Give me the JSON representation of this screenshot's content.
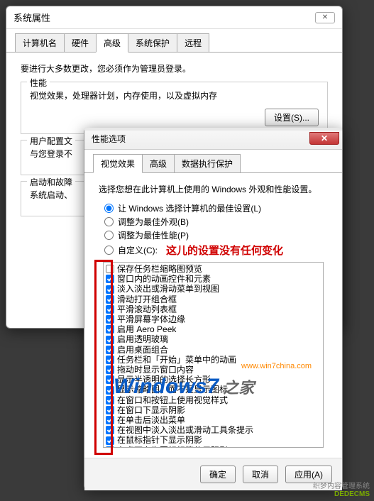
{
  "bg": {
    "title": "系统属性",
    "tabs": [
      "计算机名",
      "硬件",
      "高级",
      "系统保护",
      "远程"
    ],
    "active_tab": 2,
    "intro": "要进行大多数更改，您必须作为管理员登录。",
    "perf_title": "性能",
    "perf_desc": "视觉效果，处理器计划，内存使用，以及虚拟内存",
    "settings_btn": "设置(S)...",
    "profile_title": "用户配置文",
    "profile_desc": "与您登录不",
    "startup_title": "启动和故障",
    "startup_desc": "系统启动、"
  },
  "fg": {
    "title": "性能选项",
    "tabs": [
      "视觉效果",
      "高级",
      "数据执行保护"
    ],
    "active_tab": 0,
    "intro": "选择您想在此计算机上使用的 Windows 外观和性能设置。",
    "radios": [
      {
        "label": "让 Windows 选择计算机的最佳设置(L)",
        "checked": true
      },
      {
        "label": "调整为最佳外观(B)",
        "checked": false
      },
      {
        "label": "调整为最佳性能(P)",
        "checked": false
      },
      {
        "label": "自定义(C):",
        "checked": false
      }
    ],
    "annotation": "这儿的设置没有任何变化",
    "checks": [
      {
        "label": "保存任务栏缩略图预览",
        "checked": false
      },
      {
        "label": "窗口内的动画控件和元素",
        "checked": true
      },
      {
        "label": "淡入淡出或滑动菜单到视图",
        "checked": true
      },
      {
        "label": "滑动打开组合框",
        "checked": true
      },
      {
        "label": "平滑滚动列表框",
        "checked": true
      },
      {
        "label": "平滑屏幕字体边缘",
        "checked": true
      },
      {
        "label": "启用 Aero Peek",
        "checked": true
      },
      {
        "label": "启用透明玻璃",
        "checked": true
      },
      {
        "label": "启用桌面组合",
        "checked": true
      },
      {
        "label": "任务栏和「开始」菜单中的动画",
        "checked": true
      },
      {
        "label": "拖动时显示窗口内容",
        "checked": true
      },
      {
        "label": "显示半透明的选择长方形",
        "checked": true
      },
      {
        "label": "显示缩略图，而不是显示图标",
        "checked": true
      },
      {
        "label": "在窗口和按钮上使用视觉样式",
        "checked": true
      },
      {
        "label": "在窗口下显示阴影",
        "checked": true
      },
      {
        "label": "在单击后淡出菜单",
        "checked": true
      },
      {
        "label": "在视图中淡入淡出或滑动工具条提示",
        "checked": true
      },
      {
        "label": "在鼠标指针下显示阴影",
        "checked": true
      },
      {
        "label": "在桌面上为图标标签使用阴影",
        "checked": true
      }
    ],
    "ok": "确定",
    "cancel": "取消",
    "apply": "应用(A)"
  },
  "watermark": {
    "url": "www.win7china.com",
    "brand1": "Windows7",
    "brand2": " 之家",
    "footer1": "织梦内容管理系统",
    "footer2": "DEDECMS"
  }
}
